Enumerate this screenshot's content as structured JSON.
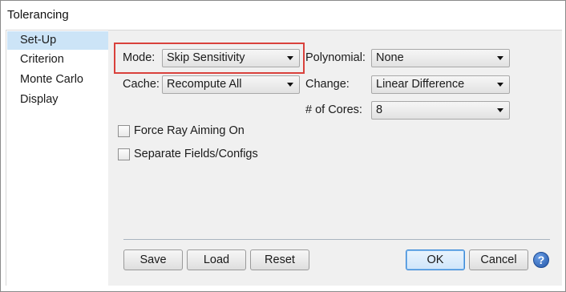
{
  "window": {
    "title": "Tolerancing"
  },
  "nav": {
    "items": [
      {
        "label": "Set-Up",
        "selected": true
      },
      {
        "label": "Criterion",
        "selected": false
      },
      {
        "label": "Monte Carlo",
        "selected": false
      },
      {
        "label": "Display",
        "selected": false
      }
    ]
  },
  "form": {
    "mode": {
      "label": "Mode:",
      "value": "Skip Sensitivity"
    },
    "cache": {
      "label": "Cache:",
      "value": "Recompute All"
    },
    "polynomial": {
      "label": "Polynomial:",
      "value": "None"
    },
    "change": {
      "label": "Change:",
      "value": "Linear Difference"
    },
    "cores": {
      "label": "# of Cores:",
      "value": "8"
    },
    "force_ray_aiming": {
      "label": "Force Ray Aiming On",
      "checked": false
    },
    "separate_fields": {
      "label": "Separate Fields/Configs",
      "checked": false
    }
  },
  "buttons": {
    "save": "Save",
    "load": "Load",
    "reset": "Reset",
    "ok": "OK",
    "cancel": "Cancel",
    "help": "?"
  },
  "colors": {
    "highlight_border": "#d9413c",
    "selected_nav": "#cce4f7",
    "panel_bg": "#f0f0f0"
  }
}
